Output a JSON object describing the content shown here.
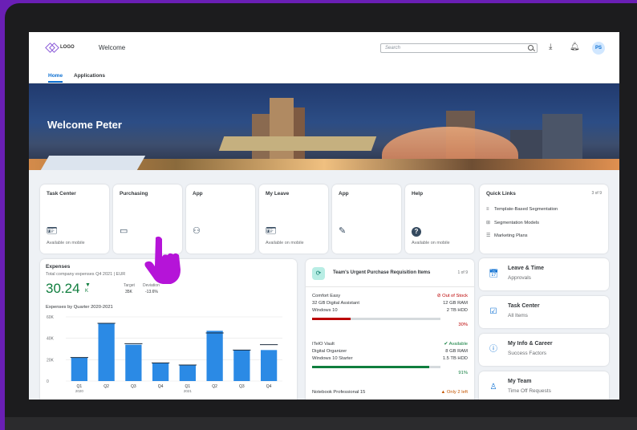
{
  "shell": {
    "logo": "LOGO",
    "title": "Welcome",
    "search_placeholder": "Search",
    "avatar": "PS"
  },
  "tabs": [
    {
      "label": "Home"
    },
    {
      "label": "Applications"
    }
  ],
  "hero": {
    "title": "Welcome Peter"
  },
  "tiles": [
    {
      "title": "Task Center",
      "footer": "Available on mobile",
      "icon": "id-card-icon"
    },
    {
      "title": "Purchasing",
      "footer": "",
      "icon": "window-icon"
    },
    {
      "title": "App",
      "footer": "",
      "icon": "group-icon"
    },
    {
      "title": "My Leave",
      "footer": "Available on mobile",
      "icon": "id-card-icon"
    },
    {
      "title": "App",
      "footer": "",
      "icon": "edit-icon"
    },
    {
      "title": "Help",
      "footer": "Available on mobile",
      "icon": "help-icon"
    }
  ],
  "quick_links": {
    "title": "Quick Links",
    "count": "3 of 9",
    "items": [
      "Template-Based Segmentation",
      "Segmentation Models",
      "Marketing Plans"
    ]
  },
  "expenses": {
    "title": "Expenses",
    "subtitle": "Total company expenses Q4 2021 | EUR",
    "kpi": "30.24",
    "kpi_unit": "K",
    "target_label": "Target",
    "target_value": "35K",
    "deviation_label": "Deviation",
    "deviation_value": "-13.6%",
    "chart_title": "Expenses by Quarter 2020-2021"
  },
  "chart_data": {
    "type": "bar",
    "title": "Expenses by Quarter 2020-2021",
    "categories": [
      "Q1",
      "Q2",
      "Q3",
      "Q4",
      "Q1",
      "Q2",
      "Q3",
      "Q4"
    ],
    "category_years": [
      "2020",
      "",
      "",
      "",
      "2021",
      "",
      "",
      ""
    ],
    "values": [
      22000,
      54000,
      34000,
      17000,
      15000,
      47000,
      29000,
      29000
    ],
    "targets": [
      22000,
      54000,
      35000,
      17000,
      15000,
      45000,
      29000,
      34000
    ],
    "y_ticks": [
      "0",
      "20K",
      "40K",
      "60K"
    ],
    "ylim": [
      0,
      60000
    ],
    "grid": true,
    "bar_color": "#2b8ae5"
  },
  "purchase": {
    "title": "Team's Urgent Purchase Requisition Items",
    "count": "1 of 9",
    "items": [
      {
        "name": "Comfort Easy",
        "status": "Out of Stock",
        "status_icon": "⊘",
        "desc1": "32 GB Digital Assistant",
        "spec1": "12 GB RAM",
        "desc2": "Windows 10",
        "spec2": "2 TB HDD",
        "percent": "30%",
        "progress": 0.3,
        "color": "#bb0000"
      },
      {
        "name": "ITelO Vault",
        "status": "Available",
        "status_icon": "✔",
        "desc1": "Digital Organizer",
        "spec1": "8 GB RAM",
        "desc2": "Windows 10 Starter",
        "spec2": "1.5 TB HDD",
        "percent": "91%",
        "progress": 0.91,
        "color": "#107e3e"
      },
      {
        "name": "Notebook Professional 15",
        "status": "Only 2 left",
        "status_icon": "▲",
        "desc1": "",
        "spec1": "",
        "desc2": "",
        "spec2": "",
        "percent": "",
        "progress": 0,
        "color": "#c35500"
      }
    ]
  },
  "nav_cards": [
    {
      "title": "Leave & Time",
      "subtitle": "Approvals",
      "icon": "calendar-icon"
    },
    {
      "title": "Task Center",
      "subtitle": "All Items",
      "icon": "task-icon"
    },
    {
      "title": "My Info & Career",
      "subtitle": "Success Factors",
      "icon": "info-icon"
    },
    {
      "title": "My Team",
      "subtitle": "Time Off Requests",
      "icon": "org-chart-icon"
    }
  ],
  "colors": {
    "accent": "#0a6ed1",
    "highlight_hand": "#b514d8",
    "frame": "#1c1c1e",
    "background": "#6a1fb5"
  }
}
